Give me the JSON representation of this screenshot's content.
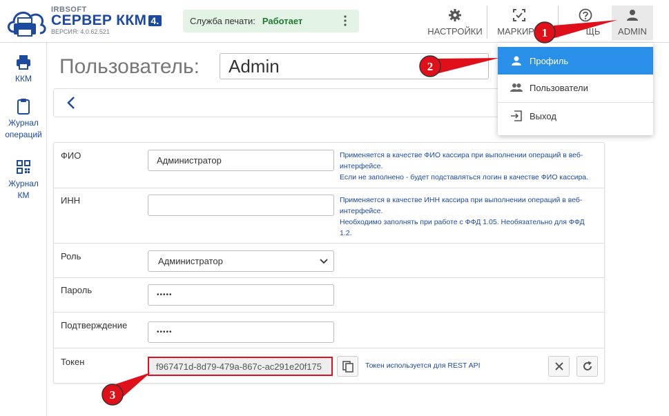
{
  "brand": {
    "vendor": "IRBSOFT",
    "product": "СЕРВЕР ККМ",
    "badge": "4.",
    "version": "ВЕРСИЯ: 4.0.62.521"
  },
  "service": {
    "label": "Служба печати:",
    "status": "Работает",
    "menu_icon": "kebab-icon",
    "status_color": "#1f7a2f"
  },
  "nav": {
    "settings": "НАСТРОЙКИ",
    "marking": "МАРКИРО",
    "help": "ЩЬ",
    "admin": "ADMIN"
  },
  "sidebar": {
    "items": [
      {
        "label": "ККМ",
        "icon": "printer-icon"
      },
      {
        "label": "Журнал операций",
        "icon": "clipboard-icon"
      },
      {
        "label": "Журнал КМ",
        "icon": "qr-code-icon"
      }
    ]
  },
  "page": {
    "title": "Пользователь:",
    "user_name": "Admin"
  },
  "form": {
    "fio": {
      "label": "ФИО",
      "value": "Администратор",
      "help_line1": "Применяется в качестве ФИО кассира при выполнении операций в веб-интерфейсе.",
      "help_line2": "Если не заполнено - будет подставляться логин в качестве ФИО кассира."
    },
    "inn": {
      "label": "ИНН",
      "value": "",
      "help_line1": "Применяется в качестве ИНН кассира при выполнении операций в веб-интерфейсе.",
      "help_line2": "Необходимо заполнять при работе с ФФД 1.05. Необязательно для ФФД 1.2."
    },
    "role": {
      "label": "Роль",
      "value": "Администратор"
    },
    "password": {
      "label": "Пароль",
      "value": "•••••"
    },
    "confirm": {
      "label": "Подтверждение",
      "value": "•••••"
    },
    "token": {
      "label": "Токен",
      "value": "f967471d-8d79-479a-867c-ac291e20f175",
      "help": "Токен используется для REST API"
    }
  },
  "user_menu": {
    "items": [
      {
        "label": "Профиль",
        "icon": "person-icon"
      },
      {
        "label": "Пользователи",
        "icon": "people-icon"
      },
      {
        "label": "Выход",
        "icon": "logout-icon"
      }
    ]
  },
  "callouts": [
    "1",
    "2",
    "3"
  ],
  "colors": {
    "brand": "#1c4aa0",
    "accent": "#2a8fe8",
    "callout": "#e0101a"
  }
}
